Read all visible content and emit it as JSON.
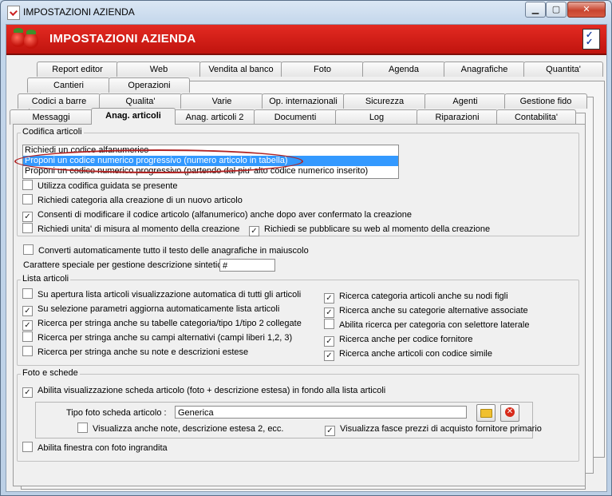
{
  "window": {
    "title": "IMPOSTAZIONI AZIENDA",
    "controls": {
      "minimize": "▁",
      "maximize": "▢",
      "close": "✕"
    }
  },
  "header": {
    "title": "IMPOSTAZIONI AZIENDA"
  },
  "tabs": {
    "row1": [
      "Report editor",
      "Web",
      "Vendita al banco",
      "Foto",
      "Agenda",
      "Anagrafiche",
      "Quantita'"
    ],
    "row2": [
      "Cantieri",
      "Operazioni"
    ],
    "row3": [
      "Codici a barre",
      "Qualita'",
      "Varie",
      "Op. internazionali",
      "Sicurezza",
      "Agenti",
      "Gestione fido"
    ],
    "row4": [
      "Messaggi",
      "Anag. articoli",
      "Anag. articoli 2",
      "Documenti",
      "Log",
      "Riparazioni",
      "Contabilita'"
    ],
    "active": "Anag. articoli"
  },
  "codifica": {
    "title": "Codifica articoli",
    "options": [
      "Richiedi un codice alfanumerico",
      "Proponi un codice numerico progressivo (numero articolo in tabella)",
      "Proponi un codice numerico progressivo (partendo dal piu' alto codice numerico inserito)"
    ],
    "selected_index": 1,
    "checks": [
      {
        "label": "Utilizza codifica guidata se presente",
        "checked": false
      },
      {
        "label": "Richiedi categoria alla creazione di un nuovo articolo",
        "checked": false
      },
      {
        "label": "Consenti di modificare il codice articolo (alfanumerico) anche dopo aver confermato la creazione",
        "checked": true
      },
      {
        "label": "Richiedi unita' di misura al momento della creazione",
        "checked": false
      },
      {
        "label": "Richiedi se pubblicare su web al momento della creazione",
        "checked": true
      }
    ]
  },
  "general": {
    "uppercase": {
      "label": "Converti automaticamente tutto il testo delle anagrafiche in maiuscolo",
      "checked": false
    },
    "special_char": {
      "label": "Carattere speciale per gestione descrizione sintetica :",
      "value": "#"
    }
  },
  "lista": {
    "title": "Lista articoli",
    "left": [
      {
        "label": "Su apertura lista articoli visualizzazione automatica di tutti gli articoli",
        "checked": false
      },
      {
        "label": "Su selezione parametri aggiorna automaticamente lista articoli",
        "checked": true
      },
      {
        "label": "Ricerca per stringa anche su tabelle categoria/tipo 1/tipo 2 collegate",
        "checked": true
      },
      {
        "label": "Ricerca per stringa anche su campi alternativi (campi liberi 1,2, 3)",
        "checked": false
      },
      {
        "label": "Ricerca per stringa anche su note e descrizioni estese",
        "checked": false
      }
    ],
    "right": [
      {
        "label": "Ricerca categoria articoli anche su nodi figli",
        "checked": true
      },
      {
        "label": "Ricerca anche su categorie alternative associate",
        "checked": true
      },
      {
        "label": "Abilita ricerca per categoria con selettore laterale",
        "checked": false
      },
      {
        "label": "Ricerca anche per codice fornitore",
        "checked": true
      },
      {
        "label": "Ricerca anche articoli con codice simile",
        "checked": true
      }
    ]
  },
  "foto": {
    "title": "Foto e schede",
    "abilita": {
      "label": "Abilita visualizzazione scheda articolo (foto + descrizione estesa) in fondo alla lista articoli",
      "checked": true
    },
    "tipo_label": "Tipo foto scheda articolo :",
    "tipo_value": "Generica",
    "note": {
      "label": "Visualizza anche note, descrizione estesa 2, ecc.",
      "checked": false
    },
    "fasce": {
      "label": "Visualizza fasce prezzi di acquisto fornitore primario",
      "checked": true
    },
    "finestra": {
      "label": "Abilita finestra con foto ingrandita",
      "checked": false
    }
  }
}
